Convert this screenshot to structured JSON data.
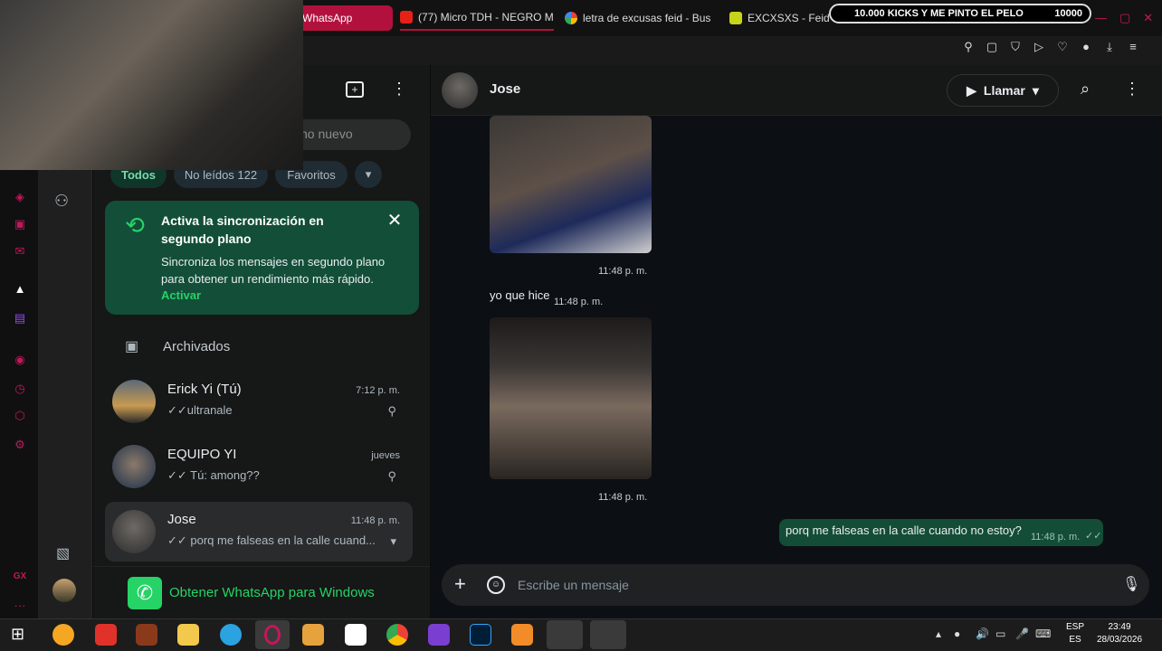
{
  "browser": {
    "tabs": [
      {
        "label": "WhatsApp",
        "active": true
      },
      {
        "label": "(77) Micro TDH - NEGRO M",
        "active": false
      },
      {
        "label": "letra de excusas feid - Bus",
        "active": false
      },
      {
        "label": "EXCXSXS - Feid - LETRA",
        "active": false
      }
    ],
    "kicks_label": "10.000 KICKS Y ME PINTO EL PELO",
    "kicks_value": "10000"
  },
  "chatlist": {
    "search_placeholder": "no nuevo",
    "filters": [
      "Todos",
      "No leídos 122",
      "Favoritos"
    ],
    "sync_banner": {
      "title": "Activa la sincronización en segundo plano",
      "body": "Sincroniza los mensajes en segundo plano para obtener un rendimiento más rápido.",
      "action": "Activar"
    },
    "archived_label": "Archivados",
    "chats": [
      {
        "name": "Erick Yi (Tú)",
        "time": "7:12 p. m.",
        "preview": "✓✓ultranale",
        "pinned": true
      },
      {
        "name": "EQUIPO YI",
        "time": "jueves",
        "preview": "✓✓ Tú: among??",
        "pinned": true
      },
      {
        "name": "Jose",
        "time": "11:48 p. m.",
        "preview": "✓✓ porq me falseas en la calle cuand...",
        "pinned": false
      }
    ],
    "get_app_label": "Obtener WhatsApp para Windows"
  },
  "conversation": {
    "contact_name": "Jose",
    "call_label": "Llamar",
    "messages": [
      {
        "type": "media",
        "time": "11:48 p. m."
      },
      {
        "type": "text",
        "text": "yo que hice",
        "time": "11:48 p. m."
      },
      {
        "type": "media",
        "time": "11:48 p. m."
      },
      {
        "type": "text-out",
        "text": "porq me falseas en la calle cuando no estoy?",
        "time": "11:48 p. m."
      }
    ],
    "composer_placeholder": "Escribe un mensaje"
  },
  "taskbar": {
    "lang": "ESP",
    "lang2": "ES",
    "time": "23:49",
    "date": "28/03/2026"
  },
  "colors": {
    "accent": "#25d366",
    "outgoing_bubble": "#144d37",
    "browser_accent": "#b3113d"
  }
}
